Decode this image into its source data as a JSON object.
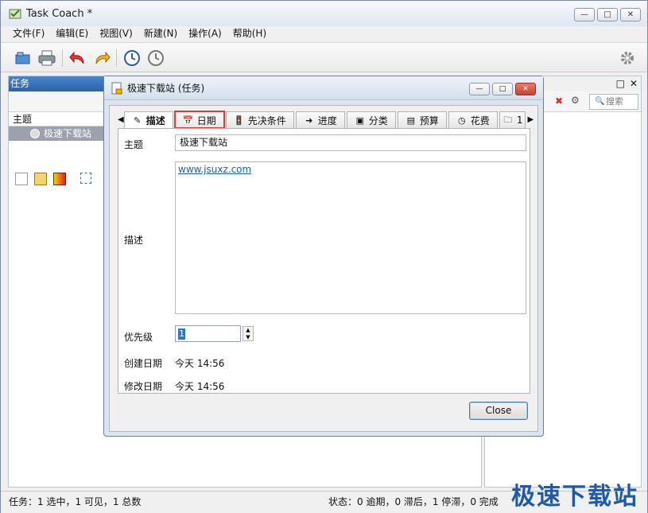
{
  "app": {
    "title": "Task Coach *",
    "menu": [
      "文件(F)",
      "编辑(E)",
      "视图(V)",
      "新建(N)",
      "操作(A)",
      "帮助(H)"
    ],
    "window_buttons": [
      "—",
      "□",
      "✕"
    ]
  },
  "toolbar": {
    "icons": [
      "open-icon",
      "print-icon",
      "undo-icon",
      "redo-icon",
      "clock-start-icon",
      "clock-stop-icon",
      "settings-icon"
    ]
  },
  "task_panel": {
    "title": "任务",
    "column_header": "主题",
    "tasks": [
      {
        "name": "极速下载站"
      }
    ]
  },
  "right_panel": {
    "controls": [
      "□",
      "✕"
    ],
    "search_placeholder": "搜索"
  },
  "dialog": {
    "title": "极速下载站 (任务)",
    "tabs": [
      {
        "label": "描述",
        "icon": "pencil-icon",
        "active": true
      },
      {
        "label": "日期",
        "icon": "calendar-icon",
        "highlighted": true
      },
      {
        "label": "先决条件",
        "icon": "traffic-light-icon"
      },
      {
        "label": "进度",
        "icon": "arrow-right-icon"
      },
      {
        "label": "分类",
        "icon": "category-icon"
      },
      {
        "label": "预算",
        "icon": "spreadsheet-icon"
      },
      {
        "label": "花费",
        "icon": "clock-icon"
      },
      {
        "label": "1",
        "icon": "note-icon"
      }
    ],
    "fields": {
      "subject_label": "主题",
      "subject_value": "极速下载站",
      "description_label": "描述",
      "description_value": "www.jsuxz.com",
      "priority_label": "优先级",
      "priority_value": "1",
      "created_label": "创建日期",
      "created_value": "今天 14:56",
      "modified_label": "修改日期",
      "modified_value": "今天 14:56"
    },
    "close_button": "Close"
  },
  "status": {
    "left": "任务：1 选中，1 可见，1 总数",
    "right": "状态：0 逾期，0 滞后，1 停滞，0 完成"
  },
  "watermark": "极速下载站"
}
